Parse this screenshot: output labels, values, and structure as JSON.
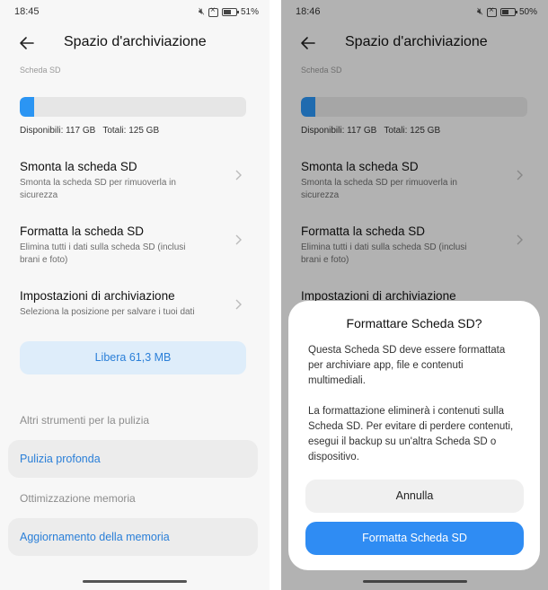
{
  "left": {
    "status": {
      "time": "18:45",
      "battery": "51%",
      "battery_level": 0.51
    },
    "title": "Spazio d'archiviazione",
    "section_label": "Scheda SD",
    "storage": {
      "available": "Disponibili: 117 GB",
      "total": "Totali: 125 GB",
      "used_fraction": 0.064
    },
    "menu": [
      {
        "title": "Smonta la scheda SD",
        "subtitle": "Smonta la scheda SD per rimuoverla in sicurezza"
      },
      {
        "title": "Formatta la scheda SD",
        "subtitle": "Elimina tutti i dati sulla scheda SD (inclusi brani e foto)"
      },
      {
        "title": "Impostazioni di archiviazione",
        "subtitle": "Seleziona la posizione per salvare i tuoi dati"
      }
    ],
    "free_button": "Libera 61,3 MB",
    "tools_label": "Altri strumenti per la pulizia",
    "deep_clean": "Pulizia profonda",
    "memory_label": "Ottimizzazione memoria",
    "memory_update": "Aggiornamento della memoria"
  },
  "right": {
    "status": {
      "time": "18:46",
      "battery": "50%",
      "battery_level": 0.5
    },
    "title": "Spazio d'archiviazione",
    "section_label": "Scheda SD",
    "storage": {
      "available": "Disponibili: 117 GB",
      "total": "Totali: 125 GB",
      "used_fraction": 0.064
    },
    "menu": [
      {
        "title": "Smonta la scheda SD",
        "subtitle": "Smonta la scheda SD per rimuoverla in sicurezza"
      },
      {
        "title": "Formatta la scheda SD",
        "subtitle": "Elimina tutti i dati sulla scheda SD (inclusi brani e foto)"
      },
      {
        "title": "Impostazioni di archiviazione"
      }
    ],
    "dialog": {
      "title": "Formattare Scheda SD?",
      "paragraph1": "Questa Scheda SD deve essere formattata per archiviare app, file e contenuti multimediali.",
      "paragraph2": "La formattazione eliminerà i contenuti sulla Scheda SD. Per evitare di perdere contenuti, esegui il backup su un'altra Scheda SD o dispositivo.",
      "cancel": "Annulla",
      "confirm": "Formatta Scheda SD"
    }
  },
  "colors": {
    "accent": "#2f8cf3",
    "accent_text": "#2a7fd8",
    "free_bg": "#deedfa"
  }
}
